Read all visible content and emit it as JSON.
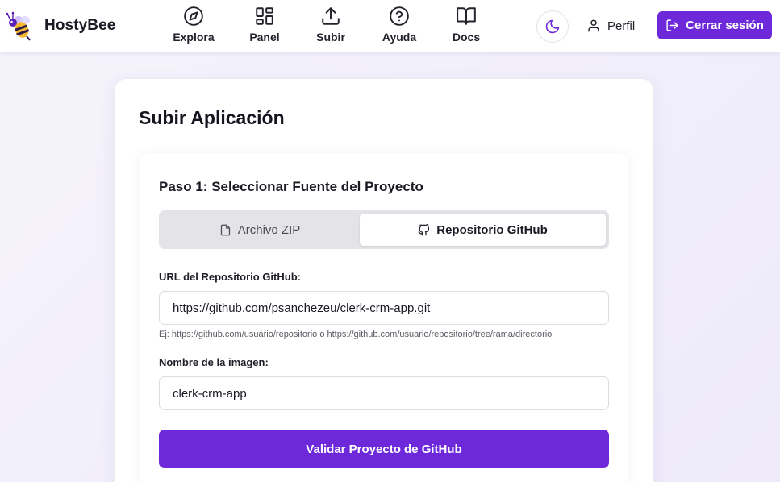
{
  "brand": {
    "name": "HostyBee",
    "logo_icon": "bee-logo-icon"
  },
  "nav": {
    "items": [
      {
        "label": "Explora",
        "icon": "compass-icon"
      },
      {
        "label": "Panel",
        "icon": "dashboard-grid-icon"
      },
      {
        "label": "Subir",
        "icon": "upload-icon"
      },
      {
        "label": "Ayuda",
        "icon": "help-circle-icon"
      },
      {
        "label": "Docs",
        "icon": "book-open-icon"
      }
    ]
  },
  "header": {
    "theme_toggle_icon": "moon-icon",
    "profile_label": "Perfil",
    "logout_label": "Cerrar sesión"
  },
  "page": {
    "title": "Subir Aplicación",
    "step_title": "Paso 1: Seleccionar Fuente del Proyecto"
  },
  "source_tabs": {
    "zip_label": "Archivo ZIP",
    "github_label": "Repositorio GitHub",
    "active": "github"
  },
  "form": {
    "repo_url_label": "URL del Repositorio GitHub:",
    "repo_url_value": "https://github.com/psanchezeu/clerk-crm-app.git",
    "repo_url_hint": "Ej: https://github.com/usuario/repositorio o https://github.com/usuario/repositorio/tree/rama/directorio",
    "image_name_label": "Nombre de la imagen:",
    "image_name_value": "clerk-crm-app",
    "validate_label": "Validar Proyecto de GitHub"
  },
  "colors": {
    "accent": "#6d28d9",
    "background": "#f3f1fa",
    "card": "#ffffff",
    "tab_track": "#e4e3e8"
  }
}
